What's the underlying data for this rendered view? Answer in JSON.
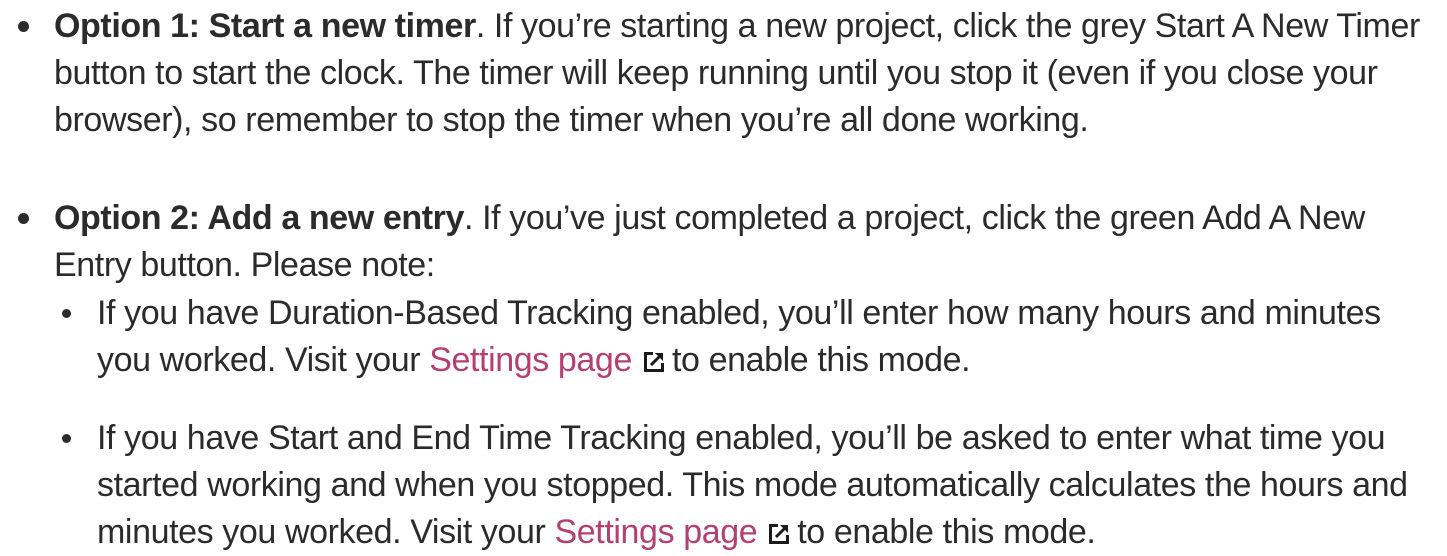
{
  "list": {
    "option1": {
      "lead": "Option 1: Start a new timer",
      "text": ". If you’re starting a new project, click the grey Start A New Timer button to start the clock. The timer will keep running until you stop it (even if you close your browser), so remember to stop the timer when you’re all done working."
    },
    "option2": {
      "lead": "Option 2: Add a new entry",
      "text": ". If you’ve just completed a project, click the green Add A New Entry button. Please note:"
    },
    "notes": [
      {
        "text_before": "If you have Duration-Based Tracking enabled, you’ll enter how many hours and minutes you worked. Visit your ",
        "link": "Settings page",
        "text_after": "to enable this mode."
      },
      {
        "text_before": "If you have Start and End Time Tracking enabled, you’ll be asked to enter what time you started working and when you stopped. This mode automatically calculates the hours and minutes you worked. Visit your ",
        "link": "Settings page",
        "text_after": "to enable this mode."
      }
    ]
  },
  "icons": {
    "external_link": "external-link-icon"
  },
  "colors": {
    "text": "#2b2b2b",
    "link": "#b43f71"
  }
}
